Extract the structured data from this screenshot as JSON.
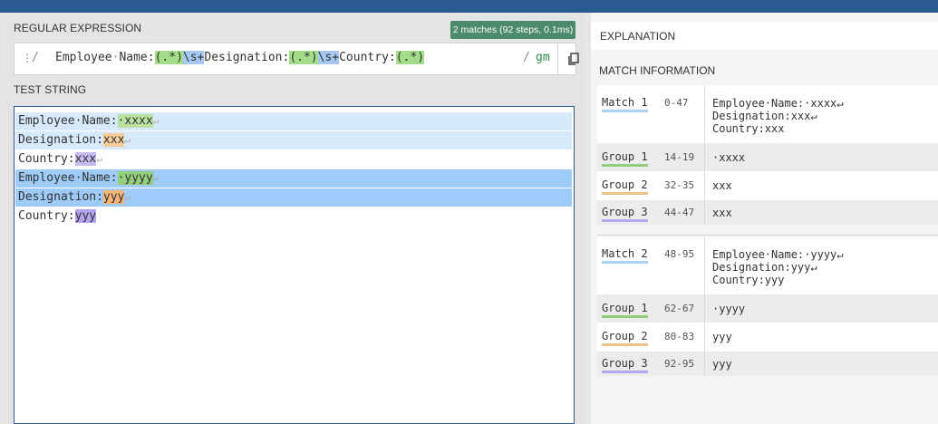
{
  "regex_panel": {
    "title": "REGULAR EXPRESSION",
    "badge": "2 matches (92 steps, 0.1ms)",
    "delimiter_open": "/",
    "delimiter_close": "/",
    "pattern_parts": [
      {
        "text": "Employee",
        "kind": "plain"
      },
      {
        "text": "·",
        "kind": "space"
      },
      {
        "text": "Name:",
        "kind": "plain"
      },
      {
        "text": "(.*)",
        "kind": "group"
      },
      {
        "text": "\\s+",
        "kind": "esc"
      },
      {
        "text": "Designation:",
        "kind": "plain"
      },
      {
        "text": "(.*)",
        "kind": "group"
      },
      {
        "text": "\\s+",
        "kind": "esc"
      },
      {
        "text": "Country:",
        "kind": "plain"
      },
      {
        "text": "(.*)",
        "kind": "group"
      }
    ],
    "flags": "gm",
    "drag_icon": "drag-handle-icon",
    "copy_icon": "copy-icon"
  },
  "test_string": {
    "title": "TEST STRING",
    "lines": [
      {
        "prefix": "Employee·Name:",
        "group": "·xxxx",
        "ret": true,
        "match": 1,
        "gclass": "g1"
      },
      {
        "prefix": "Designation:",
        "group": "xxx",
        "ret": true,
        "match": 1,
        "gclass": "g2"
      },
      {
        "prefix": "Country:",
        "group": "xxx",
        "ret": true,
        "match": 0,
        "gclass": "g3"
      },
      {
        "prefix": "Employee·Name:",
        "group": "·yyyy",
        "ret": true,
        "match": 2,
        "gclass": "g1b"
      },
      {
        "prefix": "Designation:",
        "group": "yyy",
        "ret": true,
        "match": 2,
        "gclass": "g2b"
      },
      {
        "prefix": "Country:",
        "group": "yyy",
        "ret": false,
        "match": 0,
        "gclass": "g3b"
      }
    ]
  },
  "explanation": {
    "title": "EXPLANATION"
  },
  "match_info": {
    "title": "MATCH INFORMATION",
    "matches": [
      {
        "label": "Match 1",
        "range": "0-47",
        "value": "Employee·Name:·xxxx↵\nDesignation:xxx↵\nCountry:xxx",
        "groups": [
          {
            "label": "Group 1",
            "range": "14-19",
            "value": "·xxxx"
          },
          {
            "label": "Group 2",
            "range": "32-35",
            "value": "xxx"
          },
          {
            "label": "Group 3",
            "range": "44-47",
            "value": "xxx"
          }
        ]
      },
      {
        "label": "Match 2",
        "range": "48-95",
        "value": "Employee·Name:·yyyy↵\nDesignation:yyy↵\nCountry:yyy",
        "groups": [
          {
            "label": "Group 1",
            "range": "62-67",
            "value": "·yyyy"
          },
          {
            "label": "Group 2",
            "range": "80-83",
            "value": "yyy"
          },
          {
            "label": "Group 3",
            "range": "92-95",
            "value": "yyy"
          }
        ]
      }
    ]
  }
}
